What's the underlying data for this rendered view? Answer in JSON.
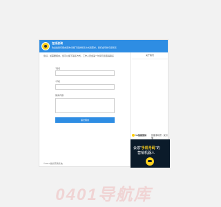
{
  "header": {
    "title": "在线咨询",
    "subtitle": "欢迎给我们留言咨询!请留下您的联系方式和需求，我们会尽快与您联系"
  },
  "notice": "您好，如需要留言，您可以留下联系方式，工作人员会第一时间与您取得联系",
  "form": {
    "name_label": "*姓名",
    "phone_label": "*手机",
    "content_label": "留言内容",
    "name_value": "",
    "phone_value": "",
    "content_value": "",
    "submit_label": "提交留言"
  },
  "footer": "©2021 数智营销系统",
  "side": {
    "title": "关于我们",
    "ad_brand": "5G智能营销",
    "ad_tag": "智能手机号 · 双引擎",
    "ad_line1_prefix": "会拨",
    "ad_line1_highlight": "手机号码",
    "ad_line1_suffix": "的",
    "ad_line2": "营销机器人"
  },
  "watermark": "0401导航库",
  "colors": {
    "accent": "#2e8de3",
    "ad_bg": "#0b1b2a",
    "ad_highlight": "#ffd21e"
  }
}
